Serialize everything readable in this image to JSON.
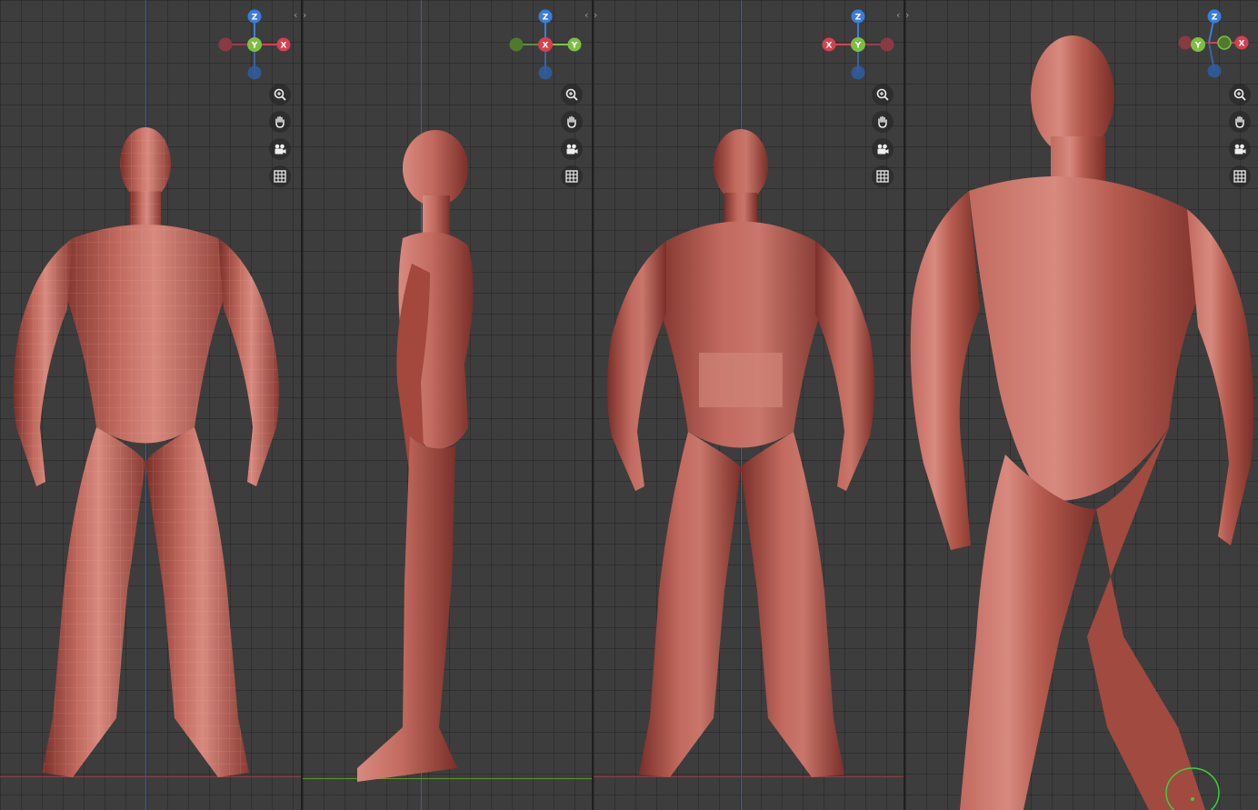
{
  "colors": {
    "background": "#3d3d3d",
    "grid_line": "#333333",
    "axis_z": "#3a5fa8",
    "axis_x": "#d6404f",
    "axis_y": "#7bc043",
    "axis_z_ball": "#3b7dd8",
    "mesh_base": "#b55a4e",
    "mesh_highlight": "#d88a7f",
    "mesh_shadow": "#7a2f28",
    "cursor_ring": "#3ad13a"
  },
  "viewports": [
    {
      "name": "front",
      "gizmo": {
        "top": "Z",
        "center": "Y",
        "right": "X"
      },
      "nav_icons": [
        "zoom-icon",
        "pan-hand-icon",
        "camera-icon",
        "grid-icon"
      ]
    },
    {
      "name": "side",
      "gizmo": {
        "top": "Z",
        "center": "X",
        "right": "Y"
      },
      "nav_icons": [
        "zoom-icon",
        "pan-hand-icon",
        "camera-icon",
        "grid-icon"
      ]
    },
    {
      "name": "back",
      "gizmo": {
        "top": "Z",
        "center": "Y",
        "left": "X"
      },
      "nav_icons": [
        "zoom-icon",
        "pan-hand-icon",
        "camera-icon",
        "grid-icon"
      ]
    },
    {
      "name": "perspective",
      "gizmo": {
        "top": "Z",
        "center": "Y",
        "right": "X"
      },
      "nav_icons": [
        "zoom-icon",
        "pan-hand-icon",
        "camera-icon",
        "grid-icon"
      ]
    }
  ]
}
